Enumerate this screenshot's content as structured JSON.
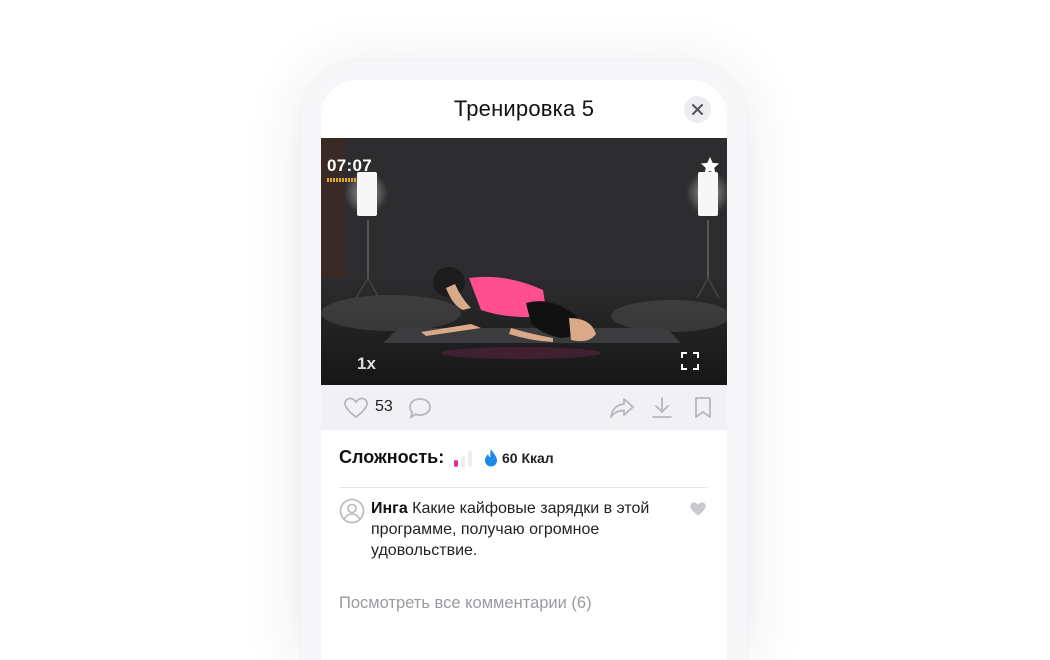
{
  "header": {
    "title": "Тренировка 5"
  },
  "video": {
    "elapsed": "07:07",
    "speed": "1x"
  },
  "actions": {
    "likes": "53"
  },
  "details": {
    "difficulty_label": "Сложность:",
    "difficulty_level": 1,
    "difficulty_max": 3,
    "calories": "60 Ккал"
  },
  "comment": {
    "author": "Инга",
    "text": " Какие кайфовые зарядки в этой программе, получаю огромное удовольствие."
  },
  "comments_link": "Посмотреть все комментарии (6)",
  "colors": {
    "accent_pink": "#e8308a",
    "accent_blue": "#1e88e5",
    "icon_gray": "#b6b6bd"
  }
}
